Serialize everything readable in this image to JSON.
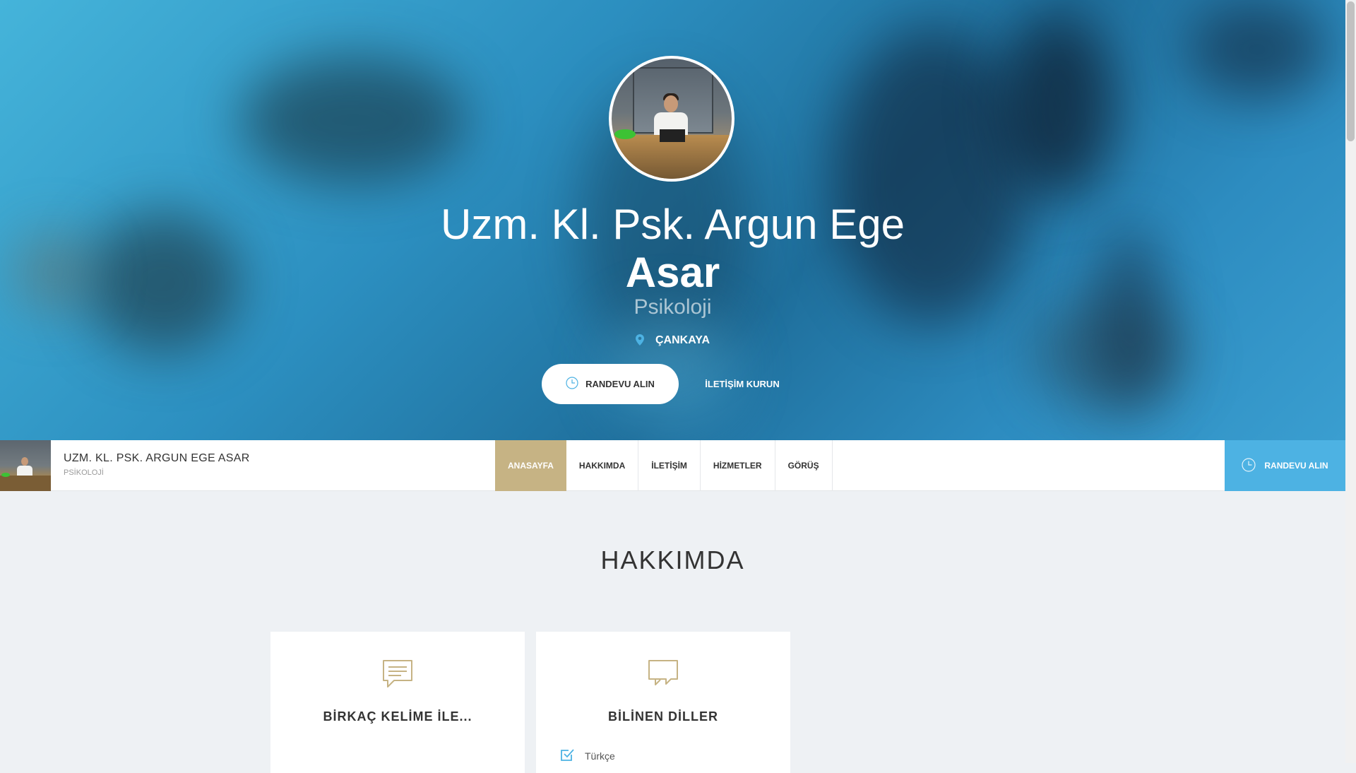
{
  "hero": {
    "name_line1": "Uzm. Kl. Psk. Argun Ege",
    "name_line2": "Asar",
    "specialty": "Psikoloji",
    "location": "ÇANKAYA",
    "primary_button": "RANDEVU ALIN",
    "secondary_button": "İLETİŞİM KURUN"
  },
  "nav": {
    "title": "UZM. KL. PSK. ARGUN EGE ASAR",
    "subtitle": "PSİKOLOJİ",
    "items": [
      {
        "label": "ANASAYFA",
        "active": true
      },
      {
        "label": "HAKKIMDA",
        "active": false
      },
      {
        "label": "İLETİŞİM",
        "active": false
      },
      {
        "label": "HİZMETLER",
        "active": false
      },
      {
        "label": "GÖRÜŞ",
        "active": false
      }
    ],
    "cta": "RANDEVU ALIN"
  },
  "about": {
    "title": "HAKKIMDA",
    "cards": [
      {
        "title": "BİRKAÇ KELİME İLE...",
        "icon": "message-icon"
      },
      {
        "title": "BİLİNEN DİLLER",
        "icon": "chat-bubbles-icon",
        "languages": [
          "Türkçe"
        ]
      }
    ]
  },
  "colors": {
    "accent_gold": "#c6b384",
    "accent_blue": "#4db2e3",
    "background": "#eef1f4"
  }
}
